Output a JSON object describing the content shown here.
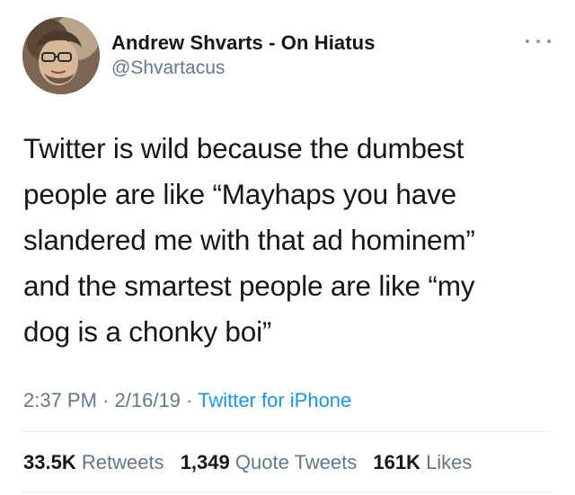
{
  "author": {
    "display_name": "Andrew Shvarts - On Hiatus",
    "handle": "@Shvartacus"
  },
  "tweet": {
    "lines": [
      "Twitter is wild because the dumbest",
      "people are like “Mayhaps you have",
      "slandered me with that ad hominem”",
      "and the smartest people are like “my",
      "dog is a chonky boi”"
    ]
  },
  "meta": {
    "time": "2:37 PM",
    "separator": "·",
    "date": "2/16/19",
    "source": "Twitter for iPhone"
  },
  "stats": {
    "retweets_count": "33.5K",
    "retweets_label": "Retweets",
    "quotes_count": "1,349",
    "quotes_label": "Quote Tweets",
    "likes_count": "161K",
    "likes_label": "Likes"
  },
  "colors": {
    "text": "#14171a",
    "secondary": "#657786",
    "link": "#1b95e0",
    "divider": "#e6ecf0"
  },
  "icons": {
    "more": "more-horizontal-icon"
  }
}
